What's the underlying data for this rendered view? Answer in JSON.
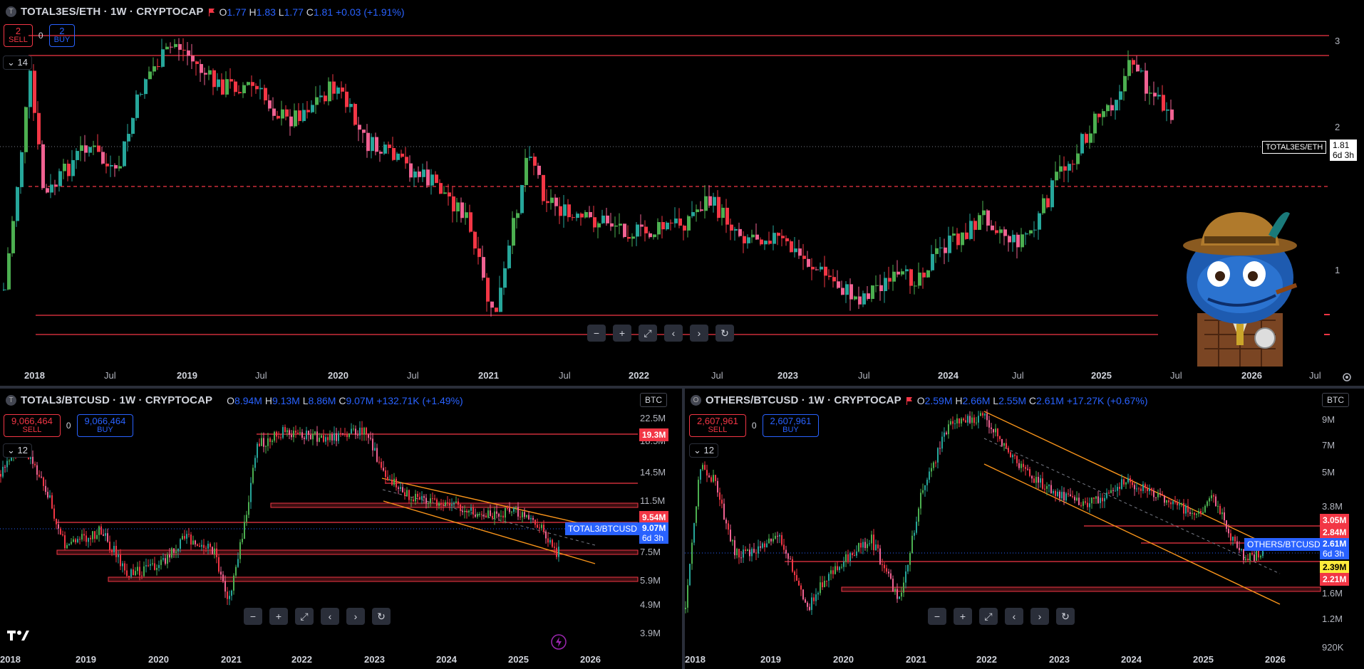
{
  "top": {
    "legend": {
      "title": "TOTAL3ES/ETH · 1W · CRYPTOCAP",
      "o": "1.77",
      "h": "1.83",
      "l": "1.77",
      "c": "1.81",
      "chg": "+0.03 (+1.91%)"
    },
    "sell": {
      "num": "2",
      "label": "SELL"
    },
    "spread": "0",
    "buy": {
      "num": "2",
      "label": "BUY"
    },
    "collapse": "14",
    "price_axis": [
      "3",
      "2",
      "1"
    ],
    "time_axis": [
      "2018",
      "Jul",
      "2019",
      "Jul",
      "2020",
      "Jul",
      "2021",
      "Jul",
      "2022",
      "Jul",
      "2023",
      "Jul",
      "2024",
      "Jul",
      "2025",
      "Jul",
      "2026",
      "Jul"
    ],
    "symbol_tag": "TOTAL3ES/ETH",
    "price_tag": "1.81",
    "countdown": "6d 3h"
  },
  "bottom_left": {
    "legend": {
      "title": "TOTAL3/BTCUSD · 1W · CRYPTOCAP",
      "o": "8.94M",
      "h": "9.13M",
      "l": "8.86M",
      "c": "9.07M",
      "chg": "+132.71K (+1.49%)"
    },
    "sell": {
      "num": "9,066,464",
      "label": "SELL"
    },
    "spread": "0",
    "buy": {
      "num": "9,066,464",
      "label": "BUY"
    },
    "collapse": "12",
    "currency": "BTC",
    "price_axis": [
      "22.5M",
      "18.5M",
      "14.5M",
      "11.5M",
      "7.5M",
      "5.9M",
      "4.9M",
      "3.9M"
    ],
    "time_axis": [
      "2018",
      "2019",
      "2020",
      "2021",
      "2022",
      "2023",
      "2024",
      "2025",
      "2026"
    ],
    "tag_red1": "19.3M",
    "tag_red2": "9.54M",
    "symbol_tag": "TOTAL3/BTCUSD",
    "price_tag": "9.07M",
    "countdown": "6d 3h"
  },
  "bottom_right": {
    "legend": {
      "title": "OTHERS/BTCUSD · 1W · CRYPTOCAP",
      "o": "2.59M",
      "h": "2.66M",
      "l": "2.55M",
      "c": "2.61M",
      "chg": "+17.27K (+0.67%)"
    },
    "sell": {
      "num": "2,607,961",
      "label": "SELL"
    },
    "spread": "0",
    "buy": {
      "num": "2,607,961",
      "label": "BUY"
    },
    "collapse": "12",
    "currency": "BTC",
    "price_axis": [
      "9M",
      "7M",
      "5M",
      "3.8M",
      "1.6M",
      "1.2M",
      "920K"
    ],
    "time_axis": [
      "2018",
      "2019",
      "2020",
      "2021",
      "2022",
      "2023",
      "2024",
      "2025",
      "2026"
    ],
    "tag_red1": "3.05M",
    "tag_red2": "2.84M",
    "symbol_tag": "OTHERS/BTCUSD",
    "price_tag": "2.61M",
    "countdown": "6d 3h",
    "tag_yellow": "2.39M",
    "tag_red3": "2.21M"
  },
  "nav_icons": [
    "minus-icon",
    "plus-icon",
    "fullscreen-icon",
    "scroll-left-icon",
    "scroll-right-icon",
    "reset-icon"
  ],
  "colors": {
    "up": "#26a69a",
    "up_bright": "#4caf50",
    "down": "#f23645",
    "level": "#f23645",
    "channel": "#f7931a",
    "accent": "#2962ff"
  }
}
